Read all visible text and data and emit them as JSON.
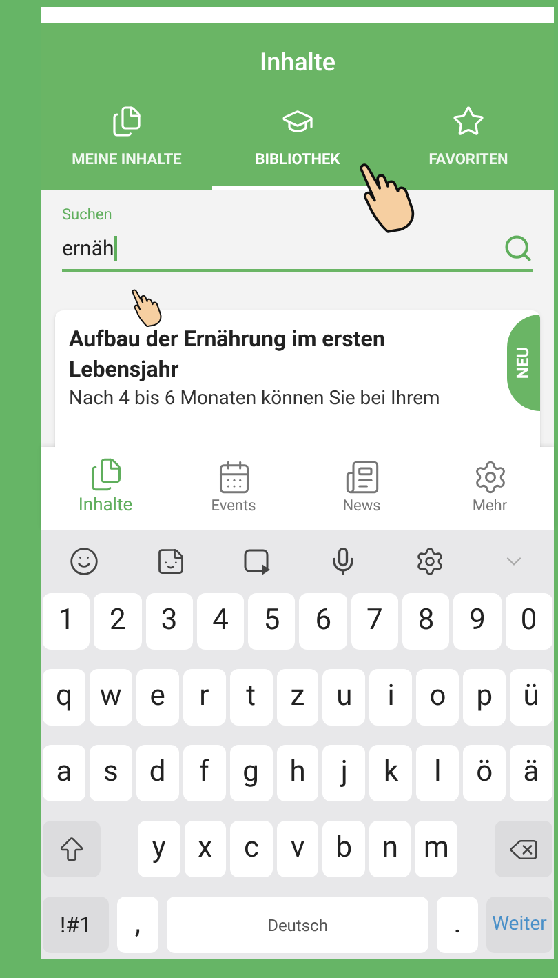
{
  "header": {
    "title": "Inhalte"
  },
  "tabs": [
    {
      "label": "MEINE INHALTE",
      "selected": false
    },
    {
      "label": "BIBLIOTHEK",
      "selected": true
    },
    {
      "label": "FAVORITEN",
      "selected": false
    }
  ],
  "search": {
    "label": "Suchen",
    "value": "ernäh"
  },
  "card": {
    "title": "Aufbau der Ernährung im ersten Lebensjahr",
    "text": "Nach 4 bis 6 Monaten können Sie bei Ihrem",
    "badge": "NEU"
  },
  "bottom_nav": [
    {
      "label": "Inhalte",
      "selected": true
    },
    {
      "label": "Events",
      "selected": false
    },
    {
      "label": "News",
      "selected": false
    },
    {
      "label": "Mehr",
      "selected": false
    }
  ],
  "keyboard": {
    "number_keys": [
      "1",
      "2",
      "3",
      "4",
      "5",
      "6",
      "7",
      "8",
      "9",
      "0"
    ],
    "rows": [
      [
        "q",
        "w",
        "e",
        "r",
        "t",
        "z",
        "u",
        "i",
        "o",
        "p",
        "ü"
      ],
      [
        "a",
        "s",
        "d",
        "f",
        "g",
        "h",
        "j",
        "k",
        "l",
        "ö",
        "ä"
      ]
    ],
    "bottom_letter_keys": [
      "y",
      "x",
      "c",
      "v",
      "b",
      "n",
      "m"
    ],
    "symbols": "!#1",
    "comma": ",",
    "space": "Deutsch",
    "period": ".",
    "action": "Weiter"
  }
}
